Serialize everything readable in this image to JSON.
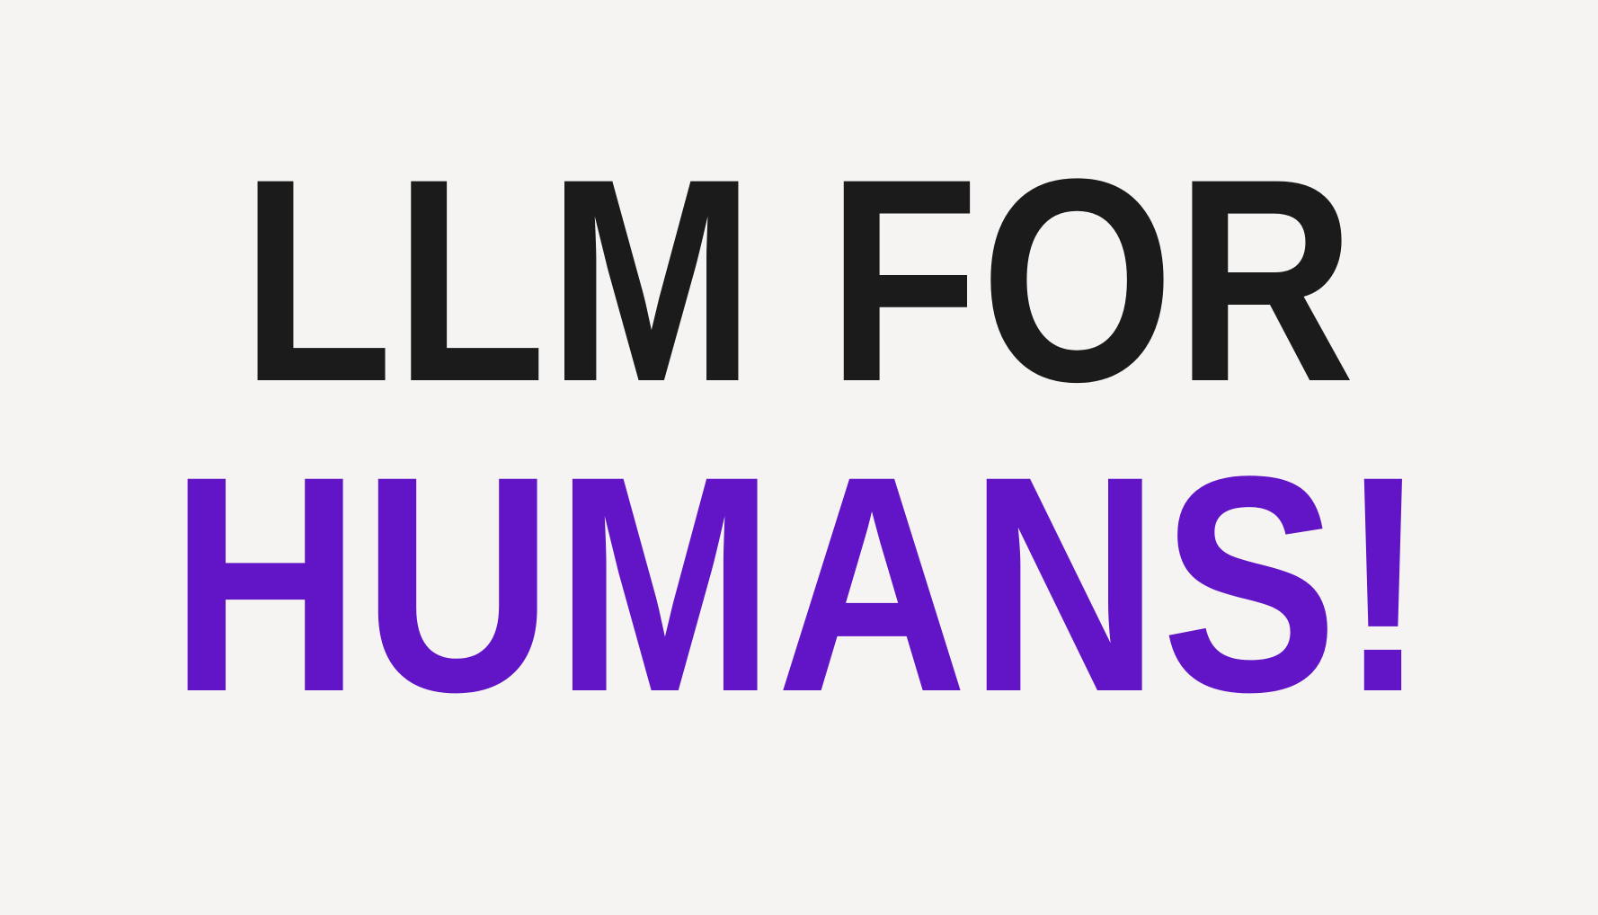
{
  "headline": {
    "line1": "LLM FOR",
    "line2": "HUMANS!"
  },
  "colors": {
    "background": "#f5f4f2",
    "line1": "#1b1b1b",
    "line2": "#6215c6"
  }
}
